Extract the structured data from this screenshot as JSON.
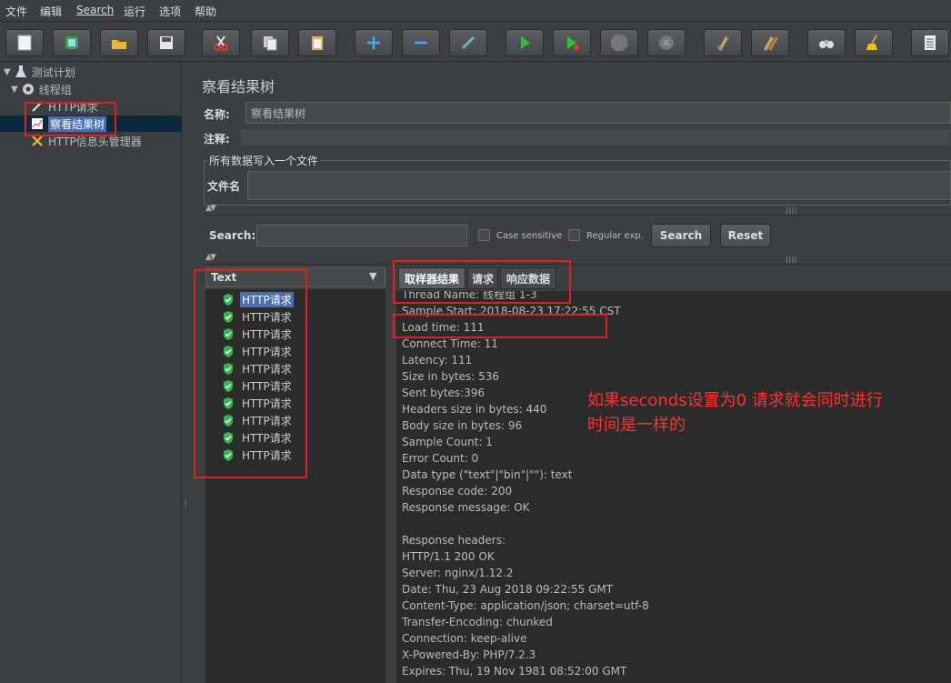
{
  "menu": [
    "文件",
    "编辑",
    "Search",
    "运行",
    "选项",
    "帮助"
  ],
  "toolbar_icons": [
    "new-icon",
    "templates-icon",
    "open-icon",
    "save-icon",
    "cut-icon",
    "copy-icon",
    "paste-icon",
    "expand-icon",
    "collapse-icon",
    "toggle-icon",
    "start-icon",
    "start-no-pause-icon",
    "stop-icon",
    "shutdown-icon",
    "clear-icon",
    "clear-all-icon",
    "search-icon",
    "reset-search-icon",
    "function-helper-icon"
  ],
  "tree": {
    "items": [
      {
        "label": "测试计划",
        "icon": "flask-icon"
      },
      {
        "label": "线程组",
        "icon": "gear-icon"
      },
      {
        "label": "HTTP请求",
        "icon": "pen-icon"
      },
      {
        "label": "察看结果树",
        "icon": "chart-icon"
      },
      {
        "label": "HTTP信息头管理器",
        "icon": "wrench-icon"
      }
    ]
  },
  "panel": {
    "title": "察看结果树",
    "name_label": "名称:",
    "name_value": "察看结果树",
    "comment_label": "注释:",
    "comment_value": "",
    "file_group_label": "所有数据写入一个文件",
    "file_label": "文件名",
    "file_value": ""
  },
  "search": {
    "label": "Search:",
    "value": "",
    "case_sensitive": "Case sensitive",
    "regular_exp": "Regular exp.",
    "search_button": "Search",
    "reset_button": "Reset"
  },
  "renderer": {
    "selected": "Text"
  },
  "results": [
    "HTTP请求",
    "HTTP请求",
    "HTTP请求",
    "HTTP请求",
    "HTTP请求",
    "HTTP请求",
    "HTTP请求",
    "HTTP请求",
    "HTTP请求",
    "HTTP请求"
  ],
  "tabs": [
    "取样器结果",
    "请求",
    "响应数据"
  ],
  "detail_lines": [
    "Thread Name: 线程组 1-3",
    "Sample Start: 2018-08-23 17:22:55 CST",
    "Load time: 111",
    "Connect Time: 11",
    "Latency: 111",
    "Size in bytes: 536",
    "Sent bytes:396",
    "Headers size in bytes: 440",
    "Body size in bytes: 96",
    "Sample Count: 1",
    "Error Count: 0",
    "Data type (\"text\"|\"bin\"|\"\"): text",
    "Response code: 200",
    "Response message: OK",
    "",
    "Response headers:",
    "HTTP/1.1 200 OK",
    "Server: nginx/1.12.2",
    "Date: Thu, 23 Aug 2018 09:22:55 GMT",
    "Content-Type: application/json; charset=utf-8",
    "Transfer-Encoding: chunked",
    "Connection: keep-alive",
    "X-Powered-By: PHP/7.2.3",
    "Expires: Thu, 19 Nov 1981 08:52:00 GMT"
  ],
  "annotation": {
    "line1": "如果seconds设置为0 请求就会同时进行",
    "line2": "时间是一样的"
  },
  "colors": {
    "annotation_red": "#e02020",
    "selection_blue": "#4b6eaf",
    "background": "#3c3f41"
  }
}
